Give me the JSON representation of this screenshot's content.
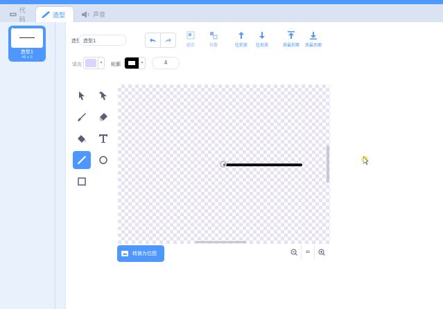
{
  "tabs": [
    {
      "label": "代码",
      "icon": "code-icon"
    },
    {
      "label": "造型",
      "icon": "brush-icon"
    },
    {
      "label": "声音",
      "icon": "speaker-icon"
    }
  ],
  "costume": {
    "number": "1",
    "name": "造型1",
    "size": "46 x 0"
  },
  "editor": {
    "costume_label": "造型",
    "costume_name_value": "造型1",
    "fill_label": "填充",
    "outline_label": "轮廓",
    "outline_width": "4",
    "actions": [
      {
        "label": "组合",
        "icon": "group-icon",
        "enabled": false
      },
      {
        "label": "拆散",
        "icon": "ungroup-icon",
        "enabled": false
      },
      {
        "label": "往前放",
        "icon": "forward-icon",
        "enabled": true
      },
      {
        "label": "往后放",
        "icon": "backward-icon",
        "enabled": true
      },
      {
        "label": "放最前面",
        "icon": "front-icon",
        "enabled": true
      },
      {
        "label": "放最后面",
        "icon": "back-icon",
        "enabled": true
      }
    ],
    "convert_button": "转换为位图",
    "zoom": {
      "out": "−",
      "reset": "=",
      "in": "+"
    }
  },
  "colors": {
    "accent": "#4d97ff",
    "fill": "#d9d4ff",
    "outline": "#000000"
  },
  "tools": [
    {
      "name": "select-tool",
      "icon": "arrow-icon"
    },
    {
      "name": "reshape-tool",
      "icon": "reshape-icon"
    },
    {
      "name": "brush-tool",
      "icon": "brush-icon"
    },
    {
      "name": "eraser-tool",
      "icon": "eraser-icon"
    },
    {
      "name": "fill-tool",
      "icon": "bucket-icon"
    },
    {
      "name": "text-tool",
      "icon": "text-icon"
    },
    {
      "name": "line-tool",
      "icon": "line-icon",
      "active": true
    },
    {
      "name": "circle-tool",
      "icon": "circle-icon"
    },
    {
      "name": "rectangle-tool",
      "icon": "rectangle-icon"
    }
  ]
}
